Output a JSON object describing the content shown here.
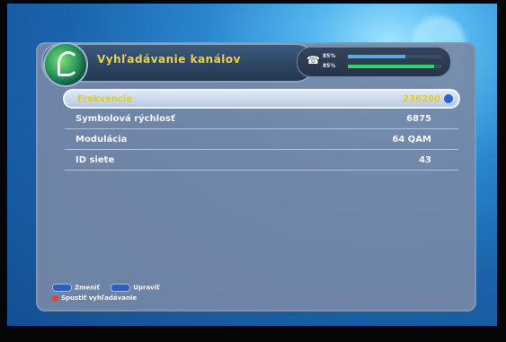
{
  "header": {
    "title": "Vyhľadávanie kanálov",
    "signal_strength_label": "85%",
    "signal_quality_label": "85%",
    "strength_fraction": 0.62,
    "quality_fraction": 0.92,
    "strength_color": "#58a9e6",
    "quality_color": "#37d16a"
  },
  "rows": [
    {
      "label": "Frekvencia",
      "value": "236200"
    },
    {
      "label": "Symbolová rýchlosť",
      "value": "6875"
    },
    {
      "label": "Modulácia",
      "value": "64 QAM"
    },
    {
      "label": "ID siete",
      "value": "43"
    }
  ],
  "footer": {
    "change_label": "Zmeniť",
    "edit_label": "Upraviť",
    "start_label": "Spustiť vyhľadávanie"
  }
}
